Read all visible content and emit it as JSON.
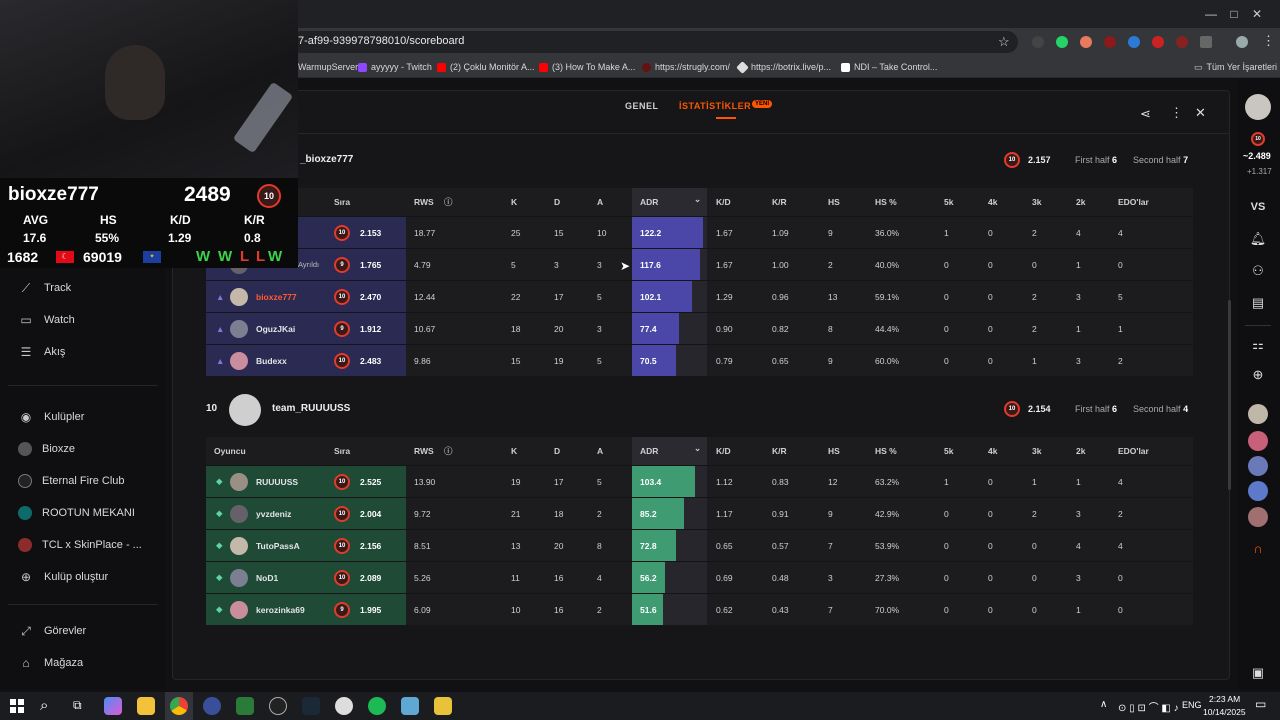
{
  "browser": {
    "url": "7-af99-939978798010/scoreboard",
    "bookmarks": [
      "WarmupServer",
      "ayyyyy - Twitch",
      "(2) Çoklu Monitör A...",
      "(3) How To Make A...",
      "https://strugly.com/",
      "https://botrix.live/p...",
      "NDI – Take Control...",
      "Tüm Yer İşaretleri"
    ]
  },
  "overlay": {
    "name": "bioxze777",
    "elo": "2489",
    "level": "10",
    "labels": [
      "AVG",
      "HS",
      "K/D",
      "K/R"
    ],
    "values": [
      "17.6",
      "55%",
      "1.29",
      "0.8"
    ],
    "rank1": "1682",
    "rank2": "69019",
    "streak": [
      "W",
      "W",
      "L",
      "L",
      "W"
    ]
  },
  "sidebar": {
    "items": [
      {
        "label": "Track",
        "icon": "trend-icon"
      },
      {
        "label": "Watch",
        "icon": "video-icon"
      },
      {
        "label": "Akış",
        "icon": "list-icon"
      }
    ],
    "clubs": [
      "Kulüpler",
      "Bioxze",
      "Eternal Fire Club",
      "ROOTUN MEKANI",
      "TCL x SkinPlace - ...",
      "Kulüp oluştur"
    ],
    "bottom": [
      "Görevler",
      "Mağaza"
    ]
  },
  "tabs": {
    "genel": "GENEL",
    "istatistikler": "İSTATİSTİKLER",
    "new_badge": "YENİ"
  },
  "team1": {
    "name": "_bioxze777",
    "elo": "2.157",
    "level": "10",
    "first_half_label": "First half",
    "first_half": "6",
    "second_half_label": "Second half",
    "second_half": "7",
    "columns": [
      "Sıra",
      "RWS",
      "K",
      "D",
      "A",
      "ADR",
      "K/D",
      "K/R",
      "HS",
      "HS %",
      "5k",
      "4k",
      "3k",
      "2k",
      "EDO'lar"
    ],
    "players": [
      {
        "name": "BatuJnAX",
        "lvl": "10",
        "elo": "2.153",
        "rws": "18.77",
        "k": "25",
        "d": "15",
        "a": "10",
        "adr": "122.2",
        "kd": "1.67",
        "kr": "1.09",
        "hs": "9",
        "hsp": "36.0%",
        "k5": "1",
        "k4": "0",
        "k3": "2",
        "k2": "4",
        "edo": "4",
        "adr_frac": 0.95
      },
      {
        "name": "bioxz...",
        "tag": "Ayrıldı",
        "lvl": "9",
        "elo": "1.765",
        "rws": "4.79",
        "k": "5",
        "d": "3",
        "a": "3",
        "adr": "117.6",
        "kd": "1.67",
        "kr": "1.00",
        "hs": "2",
        "hsp": "40.0%",
        "k5": "0",
        "k4": "0",
        "k3": "0",
        "k2": "1",
        "edo": "0",
        "adr_frac": 0.91
      },
      {
        "name": "bioxze777",
        "lvl": "10",
        "elo": "2.470",
        "rws": "12.44",
        "k": "22",
        "d": "17",
        "a": "5",
        "adr": "102.1",
        "kd": "1.29",
        "kr": "0.96",
        "hs": "13",
        "hsp": "59.1%",
        "k5": "0",
        "k4": "0",
        "k3": "2",
        "k2": "3",
        "edo": "5",
        "adr_frac": 0.8
      },
      {
        "name": "OguzJKai",
        "lvl": "9",
        "elo": "1.912",
        "rws": "10.67",
        "k": "18",
        "d": "20",
        "a": "3",
        "adr": "77.4",
        "kd": "0.90",
        "kr": "0.82",
        "hs": "8",
        "hsp": "44.4%",
        "k5": "0",
        "k4": "0",
        "k3": "2",
        "k2": "1",
        "edo": "1",
        "adr_frac": 0.62
      },
      {
        "name": "Budexx",
        "lvl": "10",
        "elo": "2.483",
        "rws": "9.86",
        "k": "15",
        "d": "19",
        "a": "5",
        "adr": "70.5",
        "kd": "0.79",
        "kr": "0.65",
        "hs": "9",
        "hsp": "60.0%",
        "k5": "0",
        "k4": "0",
        "k3": "1",
        "k2": "3",
        "edo": "2",
        "adr_frac": 0.58
      }
    ]
  },
  "team2": {
    "score": "10",
    "name": "team_RUUUUSS",
    "elo": "2.154",
    "level": "10",
    "first_half_label": "First half",
    "first_half": "6",
    "second_half_label": "Second half",
    "second_half": "4",
    "col_player": "Oyuncu",
    "columns": [
      "Sıra",
      "RWS",
      "K",
      "D",
      "A",
      "ADR",
      "K/D",
      "K/R",
      "HS",
      "HS %",
      "5k",
      "4k",
      "3k",
      "2k",
      "EDO'lar"
    ],
    "players": [
      {
        "name": "RUUUUSS",
        "lvl": "10",
        "elo": "2.525",
        "rws": "13.90",
        "k": "19",
        "d": "17",
        "a": "5",
        "adr": "103.4",
        "kd": "1.12",
        "kr": "0.83",
        "hs": "12",
        "hsp": "63.2%",
        "k5": "1",
        "k4": "0",
        "k3": "1",
        "k2": "1",
        "edo": "4",
        "adr_frac": 0.84
      },
      {
        "name": "yvzdeniz",
        "lvl": "10",
        "elo": "2.004",
        "rws": "9.72",
        "k": "21",
        "d": "18",
        "a": "2",
        "adr": "85.2",
        "kd": "1.17",
        "kr": "0.91",
        "hs": "9",
        "hsp": "42.9%",
        "k5": "0",
        "k4": "0",
        "k3": "2",
        "k2": "3",
        "edo": "2",
        "adr_frac": 0.69
      },
      {
        "name": "TutoPassA",
        "lvl": "10",
        "elo": "2.156",
        "rws": "8.51",
        "k": "13",
        "d": "20",
        "a": "8",
        "adr": "72.8",
        "kd": "0.65",
        "kr": "0.57",
        "hs": "7",
        "hsp": "53.9%",
        "k5": "0",
        "k4": "0",
        "k3": "0",
        "k2": "4",
        "edo": "4",
        "adr_frac": 0.58
      },
      {
        "name": "NoD1",
        "lvl": "10",
        "elo": "2.089",
        "rws": "5.26",
        "k": "11",
        "d": "16",
        "a": "4",
        "adr": "56.2",
        "kd": "0.69",
        "kr": "0.48",
        "hs": "3",
        "hsp": "27.3%",
        "k5": "0",
        "k4": "0",
        "k3": "0",
        "k2": "3",
        "edo": "0",
        "adr_frac": 0.44
      },
      {
        "name": "kerozinka69",
        "lvl": "9",
        "elo": "1.995",
        "rws": "6.09",
        "k": "10",
        "d": "16",
        "a": "2",
        "adr": "51.6",
        "kd": "0.62",
        "kr": "0.43",
        "hs": "7",
        "hsp": "70.0%",
        "k5": "0",
        "k4": "0",
        "k3": "0",
        "k2": "1",
        "edo": "0",
        "adr_frac": 0.41
      }
    ]
  },
  "rightrail": {
    "elo": "~2.489",
    "delta": "+1.317",
    "vs": "VS"
  },
  "taskbar": {
    "lang": "ENG",
    "time": "2:23 AM",
    "date": "10/14/2025"
  },
  "colors": {
    "accent": "#ff5500",
    "team1_row": "#2b2a52",
    "team2_row": "#1f4a36",
    "adr1": "#4b47a8",
    "adr2": "#3f9b72"
  }
}
